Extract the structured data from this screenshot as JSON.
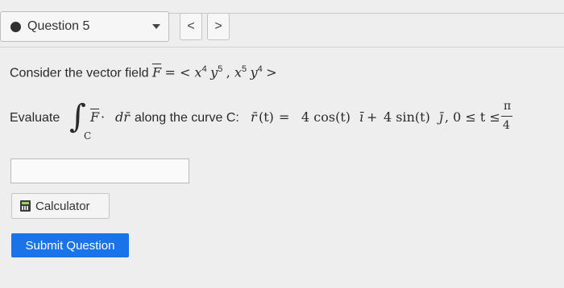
{
  "question": {
    "label": "Question 5"
  },
  "nav": {
    "prev": "<",
    "next": ">"
  },
  "prompt": {
    "consider": "Consider the vector field ",
    "F": "F",
    "eq": " = ",
    "vec_open": "< ",
    "x1": "x",
    "x1_exp": "4",
    "y1": "y",
    "y1_exp": "5",
    "comma": ", ",
    "x2": "x",
    "x2_exp": "5",
    "y2": "y",
    "y2_exp": "4",
    "vec_close": " >"
  },
  "evaluate": {
    "evaluate": "Evaluate",
    "integral": "∫",
    "sub": "C",
    "F": "F",
    "dot": " · ",
    "dr": "dr̄",
    "along": "along the curve C:",
    "r": "r̄",
    "t_arg": "(t)",
    "eq": " = ",
    "term1": "4 cos(t)",
    "i": "ī",
    "plus": " + ",
    "term2": "4 sin(t)",
    "j": "j̄",
    "range": ",  0 ≤ t ≤ ",
    "frac_num": "π",
    "frac_den": "4"
  },
  "calculator": {
    "label": "Calculator"
  },
  "submit": {
    "label": "Submit Question"
  }
}
